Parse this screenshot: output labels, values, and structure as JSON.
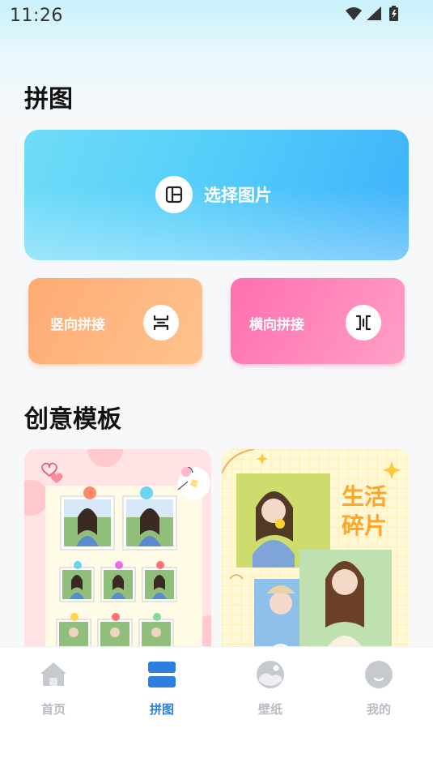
{
  "status": {
    "time": "11:26"
  },
  "collage": {
    "title": "拼图",
    "select_label": "选择图片",
    "vertical_label": "竖向拼接",
    "horizontal_label": "横向拼接"
  },
  "templates": {
    "title": "创意模板",
    "items": [
      {
        "name": "grid-photo-template"
      },
      {
        "name": "life-fragments-template",
        "text_line1": "生活",
        "text_line2": "碎片"
      }
    ]
  },
  "tabbar": {
    "items": [
      {
        "label": "首页",
        "icon": "home-icon",
        "active": false
      },
      {
        "label": "拼图",
        "icon": "collage-icon",
        "active": true
      },
      {
        "label": "壁纸",
        "icon": "wallpaper-icon",
        "active": false
      },
      {
        "label": "我的",
        "icon": "profile-icon",
        "active": false
      }
    ]
  },
  "colors": {
    "accent": "#2c7fde",
    "select_card": "#56cef9",
    "vertical_card": "#ffb57f",
    "horizontal_card": "#ff85bc",
    "tab_inactive": "#b9bcc2"
  }
}
